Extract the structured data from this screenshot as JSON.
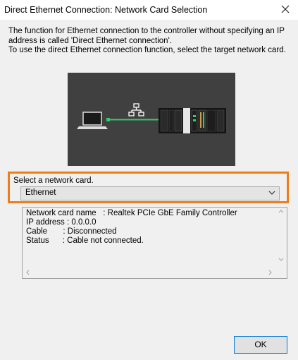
{
  "window": {
    "title": "Direct Ethernet Connection: Network Card Selection",
    "close_icon": "close-icon"
  },
  "description": {
    "line1": "The function for Ethernet connection to the controller without specifying an IP",
    "line2": "address is called 'Direct Ethernet connection'.",
    "line3": "To use the direct Ethernet connection function, select the target network card."
  },
  "graphic": {
    "background": "#404040",
    "connection_color": "#2ecc71",
    "icons": [
      "laptop-icon",
      "network-icon",
      "controller-icon"
    ]
  },
  "select": {
    "label": "Select a network card.",
    "value": "Ethernet",
    "highlight_color": "#ef7d1a"
  },
  "info": {
    "lines": [
      "Network card name   : Realtek PCIe GbE Family Controller",
      "IP address : 0.0.0.0",
      "Cable       : Disconnected",
      "Status      : Cable not connected."
    ]
  },
  "buttons": {
    "ok": "OK"
  }
}
